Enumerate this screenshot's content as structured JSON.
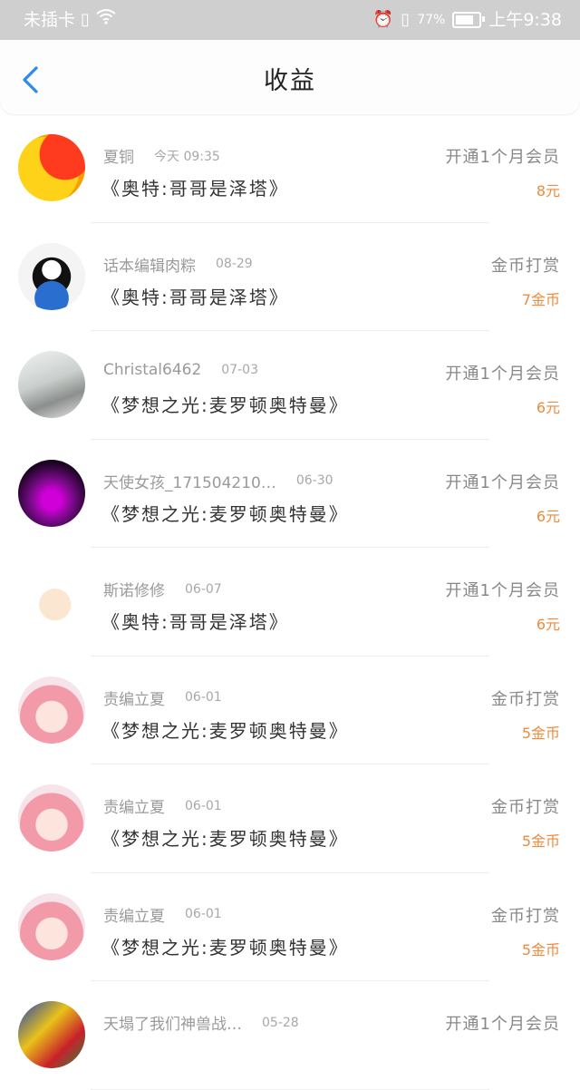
{
  "status_bar": {
    "carrier": "未插卡",
    "battery_percent": "77%",
    "battery_level": 0.77,
    "time": "上午9:38"
  },
  "header": {
    "title": "收益",
    "back_icon": "chevron-left-icon",
    "accent_color": "#2f8ae8"
  },
  "colors": {
    "amount": "#f08a3c",
    "status_bar_bg": "#cfcfcf"
  },
  "records": [
    {
      "name": "夏铜",
      "date": "今天 09:35",
      "book": "《奥特:哥哥是泽塔》",
      "type": "开通1个月会员",
      "amount": "8元"
    },
    {
      "name": "话本编辑肉粽",
      "date": "08-29",
      "book": "《奥特:哥哥是泽塔》",
      "type": "金币打赏",
      "amount": "7金币"
    },
    {
      "name": "Christal6462",
      "date": "07-03",
      "book": "《梦想之光:麦罗顿奥特曼》",
      "type": "开通1个月会员",
      "amount": "6元"
    },
    {
      "name": "天使女孩_171504210…",
      "date": "06-30",
      "book": "《梦想之光:麦罗顿奥特曼》",
      "type": "开通1个月会员",
      "amount": "6元"
    },
    {
      "name": "斯诺修修",
      "date": "06-07",
      "book": "《奥特:哥哥是泽塔》",
      "type": "开通1个月会员",
      "amount": "6元"
    },
    {
      "name": "责编立夏",
      "date": "06-01",
      "book": "《梦想之光:麦罗顿奥特曼》",
      "type": "金币打赏",
      "amount": "5金币"
    },
    {
      "name": "责编立夏",
      "date": "06-01",
      "book": "《梦想之光:麦罗顿奥特曼》",
      "type": "金币打赏",
      "amount": "5金币"
    },
    {
      "name": "责编立夏",
      "date": "06-01",
      "book": "《梦想之光:麦罗顿奥特曼》",
      "type": "金币打赏",
      "amount": "5金币"
    },
    {
      "name": "天塌了我们神兽战…",
      "date": "05-28",
      "book": "",
      "type": "开通1个月会员",
      "amount": ""
    }
  ]
}
